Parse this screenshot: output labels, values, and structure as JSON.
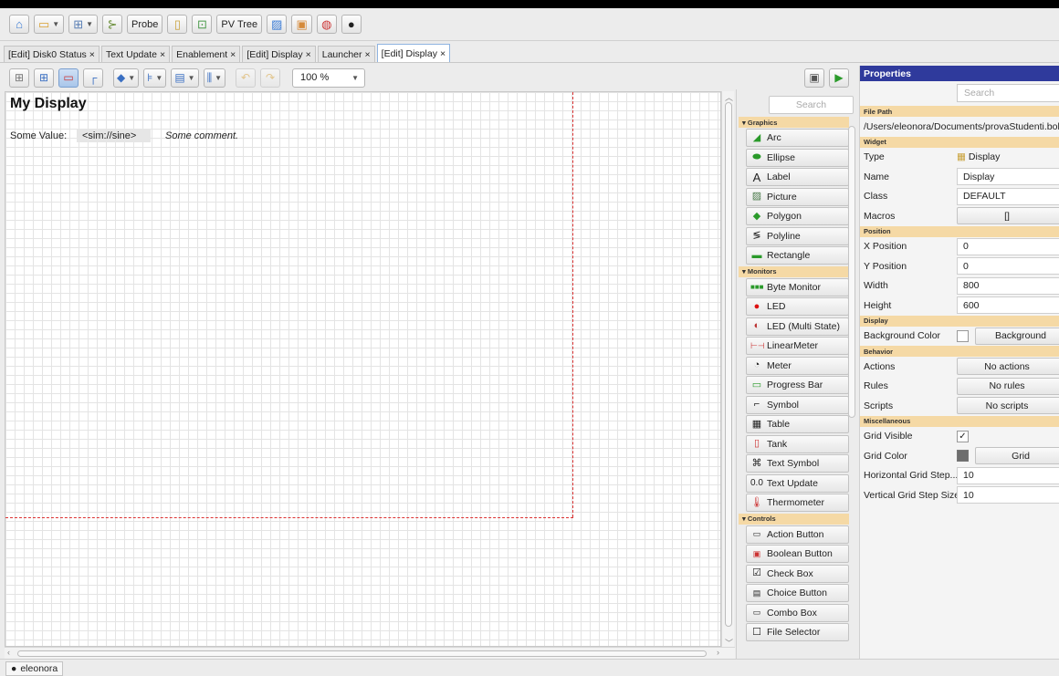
{
  "main_toolbar": {
    "home": "home-icon",
    "open": "folder-open-icon",
    "layout": "layout-icon",
    "tree": "tree-icon",
    "probe_label": "Probe",
    "pv_tree_label": "PV Tree"
  },
  "tabs": [
    {
      "label": "[Edit] Disk0 Status",
      "close": "×"
    },
    {
      "label": "Text Update",
      "close": "×"
    },
    {
      "label": "Enablement",
      "close": "×"
    },
    {
      "label": "[Edit] Display",
      "close": "×"
    },
    {
      "label": "Launcher",
      "close": "×"
    },
    {
      "label": "[Edit] Display",
      "close": "×"
    }
  ],
  "editor_toolbar": {
    "zoom": "100 %"
  },
  "canvas": {
    "title": "My Display",
    "value_label": "Some Value:",
    "pv": "<sim://sine>",
    "comment": "Some comment."
  },
  "palette": {
    "search_placeholder": "Search",
    "categories": [
      {
        "name": "Graphics",
        "items": [
          "Arc",
          "Ellipse",
          "Label",
          "Picture",
          "Polygon",
          "Polyline",
          "Rectangle"
        ]
      },
      {
        "name": "Monitors",
        "items": [
          "Byte Monitor",
          "LED",
          "LED (Multi State)",
          "LinearMeter",
          "Meter",
          "Progress Bar",
          "Symbol",
          "Table",
          "Tank",
          "Text Symbol",
          "Text Update",
          "Thermometer"
        ]
      },
      {
        "name": "Controls",
        "items": [
          "Action Button",
          "Boolean Button",
          "Check Box",
          "Choice Button",
          "Combo Box",
          "File Selector"
        ]
      }
    ],
    "text_update_prefix": "0.0"
  },
  "properties": {
    "title": "Properties",
    "search_placeholder": "Search",
    "file_path_header": "File Path",
    "file_path": "/Users/eleonora/Documents/provaStudenti.bob",
    "widget_header": "Widget",
    "type_label": "Type",
    "type_value": "Display",
    "name_label": "Name",
    "name_value": "Display",
    "class_label": "Class",
    "class_value": "DEFAULT",
    "macros_label": "Macros",
    "macros_value": "[]",
    "position_header": "Position",
    "x_label": "X Position",
    "x_value": "0",
    "y_label": "Y Position",
    "y_value": "0",
    "width_label": "Width",
    "width_value": "800",
    "height_label": "Height",
    "height_value": "600",
    "display_header": "Display",
    "bg_label": "Background Color",
    "bg_value": "Background",
    "behavior_header": "Behavior",
    "actions_label": "Actions",
    "actions_value": "No actions",
    "rules_label": "Rules",
    "rules_value": "No rules",
    "scripts_label": "Scripts",
    "scripts_value": "No scripts",
    "misc_header": "Miscellaneous",
    "grid_visible_label": "Grid Visible",
    "grid_visible_value": "✓",
    "grid_color_label": "Grid Color",
    "grid_color_value": "Grid",
    "hgrid_label": "Horizontal Grid Step...",
    "hgrid_value": "10",
    "vgrid_label": "Vertical Grid Step Size",
    "vgrid_value": "10"
  },
  "status": {
    "user": "eleonora"
  },
  "colors": {
    "accent": "#2f3a9c",
    "category_bg": "#f5d9a5",
    "display_border": "#dd3333"
  }
}
